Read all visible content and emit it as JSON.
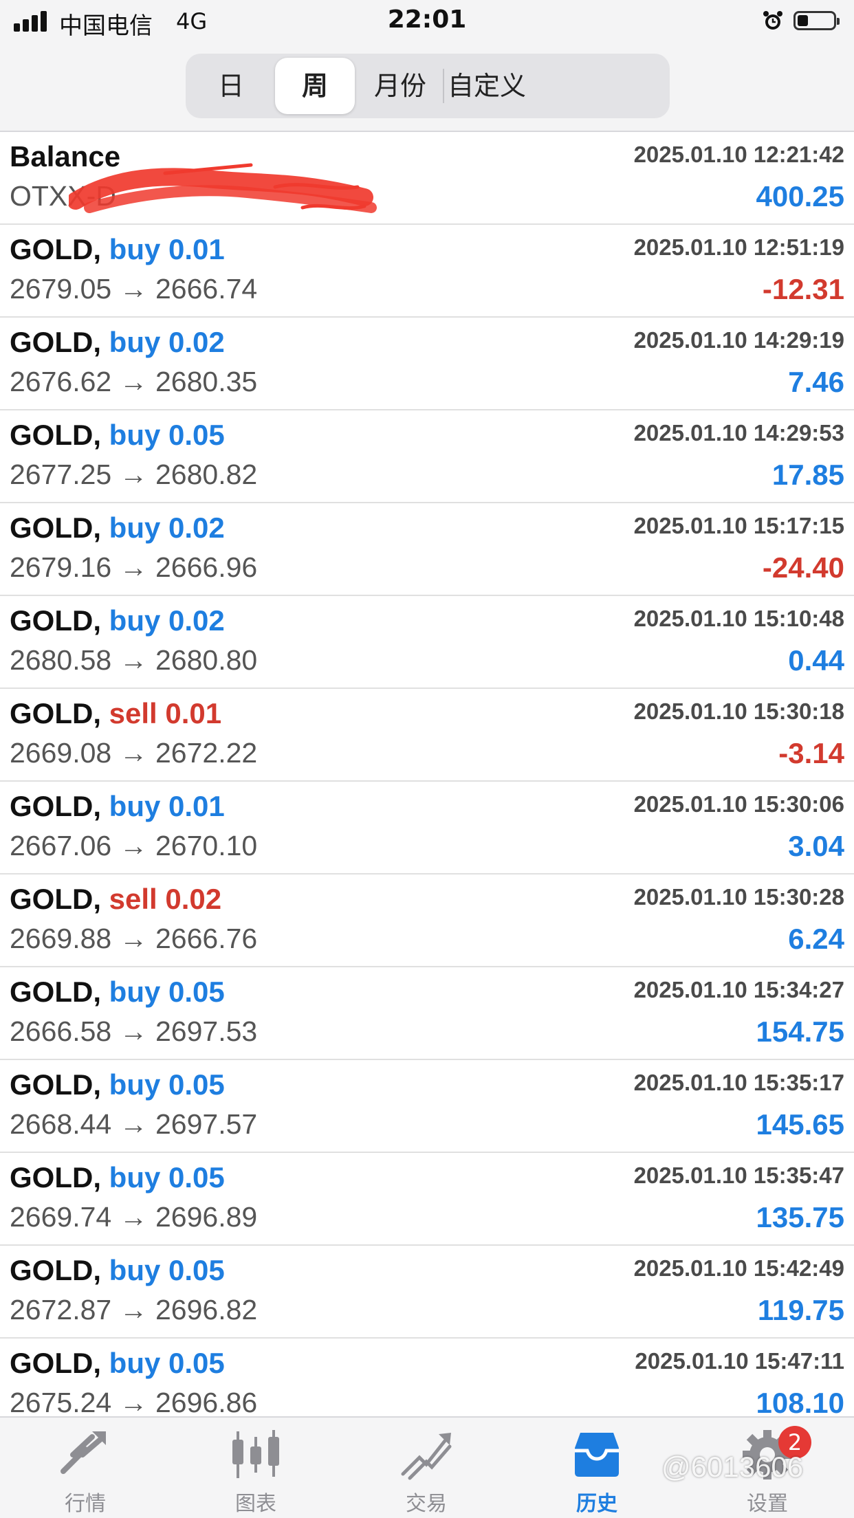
{
  "status_bar": {
    "carrier": "中国电信",
    "network": "4G",
    "time": "22:01",
    "battery_level": 0.3
  },
  "period_tabs": [
    {
      "label": "日",
      "active": false
    },
    {
      "label": "周",
      "active": true
    },
    {
      "label": "月份",
      "active": false
    },
    {
      "label": "自定义",
      "active": false
    }
  ],
  "balance": {
    "title": "Balance",
    "account": "OTXX-D",
    "time": "2025.01.10 12:21:42",
    "amount": "400.25"
  },
  "deals": [
    {
      "symbol": "GOLD,",
      "side": "buy",
      "volume": "0.01",
      "side_label": "buy 0.01",
      "prices": "2679.05 → 2666.74",
      "time": "2025.01.10 12:51:19",
      "profit": "-12.31"
    },
    {
      "symbol": "GOLD,",
      "side": "buy",
      "volume": "0.02",
      "side_label": "buy 0.02",
      "prices": "2676.62 → 2680.35",
      "time": "2025.01.10 14:29:19",
      "profit": "7.46"
    },
    {
      "symbol": "GOLD,",
      "side": "buy",
      "volume": "0.05",
      "side_label": "buy 0.05",
      "prices": "2677.25 → 2680.82",
      "time": "2025.01.10 14:29:53",
      "profit": "17.85"
    },
    {
      "symbol": "GOLD,",
      "side": "buy",
      "volume": "0.02",
      "side_label": "buy 0.02",
      "prices": "2679.16 → 2666.96",
      "time": "2025.01.10 15:17:15",
      "profit": "-24.40"
    },
    {
      "symbol": "GOLD,",
      "side": "buy",
      "volume": "0.02",
      "side_label": "buy 0.02",
      "prices": "2680.58 → 2680.80",
      "time": "2025.01.10 15:10:48",
      "profit": "0.44"
    },
    {
      "symbol": "GOLD,",
      "side": "sell",
      "volume": "0.01",
      "side_label": "sell 0.01",
      "prices": "2669.08 → 2672.22",
      "time": "2025.01.10 15:30:18",
      "profit": "-3.14"
    },
    {
      "symbol": "GOLD,",
      "side": "buy",
      "volume": "0.01",
      "side_label": "buy 0.01",
      "prices": "2667.06 → 2670.10",
      "time": "2025.01.10 15:30:06",
      "profit": "3.04"
    },
    {
      "symbol": "GOLD,",
      "side": "sell",
      "volume": "0.02",
      "side_label": "sell 0.02",
      "prices": "2669.88 → 2666.76",
      "time": "2025.01.10 15:30:28",
      "profit": "6.24"
    },
    {
      "symbol": "GOLD,",
      "side": "buy",
      "volume": "0.05",
      "side_label": "buy 0.05",
      "prices": "2666.58 → 2697.53",
      "time": "2025.01.10 15:34:27",
      "profit": "154.75"
    },
    {
      "symbol": "GOLD,",
      "side": "buy",
      "volume": "0.05",
      "side_label": "buy 0.05",
      "prices": "2668.44 → 2697.57",
      "time": "2025.01.10 15:35:17",
      "profit": "145.65"
    },
    {
      "symbol": "GOLD,",
      "side": "buy",
      "volume": "0.05",
      "side_label": "buy 0.05",
      "prices": "2669.74 → 2696.89",
      "time": "2025.01.10 15:35:47",
      "profit": "135.75"
    },
    {
      "symbol": "GOLD,",
      "side": "buy",
      "volume": "0.05",
      "side_label": "buy 0.05",
      "prices": "2672.87 → 2696.82",
      "time": "2025.01.10 15:42:49",
      "profit": "119.75"
    },
    {
      "symbol": "GOLD,",
      "side": "buy",
      "volume": "0.05",
      "side_label": "buy 0.05",
      "prices": "2675.24 → 2696.86",
      "time": "2025.01.10 15:47:11",
      "profit": "108.10"
    }
  ],
  "tabbar": [
    {
      "label": "行情",
      "icon": "quotes-icon",
      "active": false
    },
    {
      "label": "图表",
      "icon": "chart-icon",
      "active": false
    },
    {
      "label": "交易",
      "icon": "trade-icon",
      "active": false
    },
    {
      "label": "历史",
      "icon": "history-icon",
      "active": true
    },
    {
      "label": "设置",
      "icon": "settings-icon",
      "active": false,
      "badge": "2"
    }
  ],
  "watermark": "@6013606",
  "colors": {
    "accent_blue": "#1e7ee0",
    "loss_red": "#d23a2e",
    "badge_red": "#e53935"
  }
}
